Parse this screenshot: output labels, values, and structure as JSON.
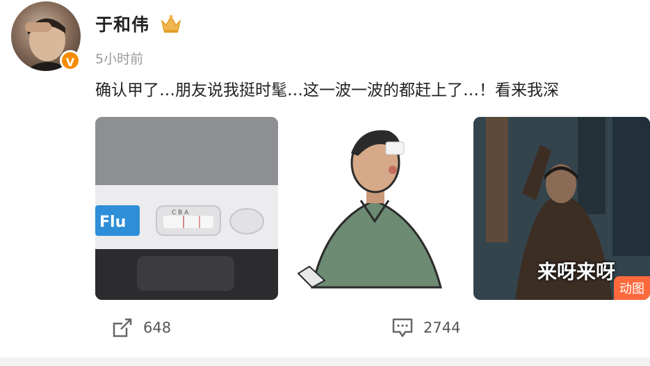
{
  "post": {
    "author": "于和伟",
    "time": "5小时前",
    "content": "确认甲了…朋友说我挺时髦…这一波一波的都赶上了…！看来我深",
    "verified_badge": "V",
    "images": [
      {
        "label": "Flu",
        "sublabel": "C  B  A"
      },
      {
        "label": ""
      },
      {
        "caption": "来呀来呀",
        "badge": "动图"
      }
    ]
  },
  "actions": {
    "share_count": "648",
    "comment_count": "2744"
  },
  "colors": {
    "verified": "#f78c00",
    "gif_badge": "#ff6a3d",
    "time": "#999999"
  }
}
